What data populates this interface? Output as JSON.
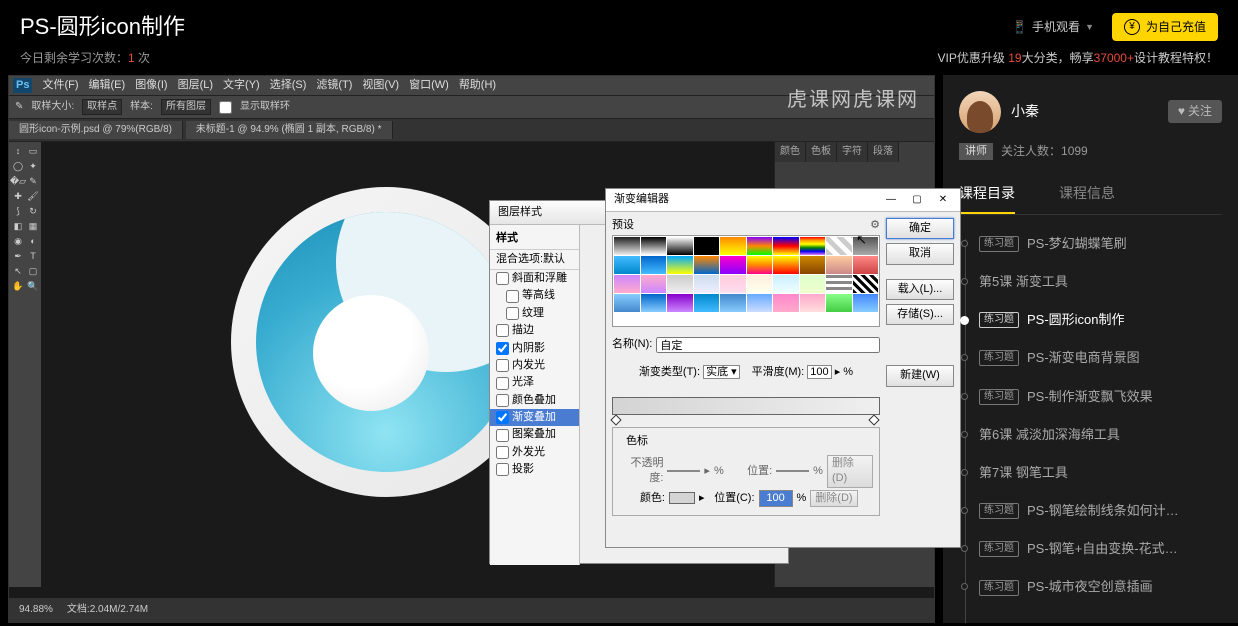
{
  "header": {
    "title": "PS-圆形icon制作",
    "mobile_watch": "手机观看",
    "recharge": "为自己充值"
  },
  "subbar": {
    "study_prefix": "今日剩余学习次数：",
    "study_count": "1",
    "study_suffix": " 次",
    "vip_p1": "VIP优惠升级 ",
    "vip_red1": "19",
    "vip_p2": "大分类，畅享",
    "vip_red2": "37000+",
    "vip_p3": "设计教程特权！"
  },
  "ps": {
    "menu": [
      "文件(F)",
      "编辑(E)",
      "图像(I)",
      "图层(L)",
      "文字(Y)",
      "选择(S)",
      "滤镜(T)",
      "视图(V)",
      "窗口(W)",
      "帮助(H)"
    ],
    "opt": {
      "sample": "取样大小:",
      "sample_val": "取样点",
      "layers": "样本:",
      "layers_val": "所有图层",
      "show": "显示取样环"
    },
    "tabs": [
      "圆形icon-示例.psd @ 79%(RGB/8)",
      "未标题-1 @ 94.9% (椭圆 1 副本, RGB/8) *"
    ],
    "watermark": "虎课网虎课网",
    "panel_tabs": [
      "颜色",
      "色板",
      "字符",
      "段落"
    ],
    "status": {
      "zoom": "94.88%",
      "doc": "文档:2.04M/2.74M"
    }
  },
  "dlg_style": {
    "title": "图层样式",
    "hd": "样式",
    "sub": "混合选项:默认",
    "items": [
      {
        "label": "斜面和浮雕",
        "chk": false
      },
      {
        "label": "等高线",
        "chk": false,
        "indent": true
      },
      {
        "label": "纹理",
        "chk": false,
        "indent": true
      },
      {
        "label": "描边",
        "chk": false
      },
      {
        "label": "内阴影",
        "chk": true
      },
      {
        "label": "内发光",
        "chk": false
      },
      {
        "label": "光泽",
        "chk": false
      },
      {
        "label": "颜色叠加",
        "chk": false
      },
      {
        "label": "渐变叠加",
        "chk": true,
        "sel": true
      },
      {
        "label": "图案叠加",
        "chk": false
      },
      {
        "label": "外发光",
        "chk": false
      },
      {
        "label": "投影",
        "chk": false
      }
    ]
  },
  "dlg_grad": {
    "title": "渐变编辑器",
    "preset_label": "预设",
    "buttons": {
      "ok": "确定",
      "cancel": "取消",
      "load": "载入(L)...",
      "save": "存储(S)...",
      "new": "新建(W)"
    },
    "name_label": "名称(N):",
    "name_val": "自定",
    "type_label": "渐变类型(T):",
    "type_val": "实底",
    "smooth_label": "平滑度(M):",
    "smooth_val": "100",
    "smooth_unit": "%",
    "stops_label": "色标",
    "opacity_label": "不透明度:",
    "opacity_unit": "%",
    "pos_label": "位置:",
    "del1": "删除(D)",
    "color_label": "颜色:",
    "pos_label2": "位置(C):",
    "pos_val": "100",
    "del2": "删除(D)"
  },
  "sidebar": {
    "author_name": "小秦",
    "follow": "关注",
    "teacher_tag": "讲师",
    "followers_label": "关注人数：",
    "followers": "1099",
    "tabs": [
      "课程目录",
      "课程信息"
    ],
    "exercise_tag": "练习题",
    "lessons": [
      {
        "tag": true,
        "label": "PS-梦幻蝴蝶笔刷"
      },
      {
        "tag": false,
        "label": "第5课 渐变工具"
      },
      {
        "tag": true,
        "label": "PS-圆形icon制作",
        "current": true
      },
      {
        "tag": true,
        "label": "PS-渐变电商背景图"
      },
      {
        "tag": true,
        "label": "PS-制作渐变飘飞效果"
      },
      {
        "tag": false,
        "label": "第6课 减淡加深海绵工具"
      },
      {
        "tag": false,
        "label": "第7课 钢笔工具"
      },
      {
        "tag": true,
        "label": "PS-钢笔绘制线条如何计…"
      },
      {
        "tag": true,
        "label": "PS-钢笔+自由变换-花式…"
      },
      {
        "tag": true,
        "label": "PS-城市夜空创意插画"
      }
    ]
  },
  "swatches": [
    "linear-gradient(#222,#eee)",
    "linear-gradient(#000,#fff)",
    "linear-gradient(#fff,#000)",
    "#000",
    "linear-gradient(#f80,#ff0)",
    "linear-gradient(#80f,#f80,#0f0)",
    "linear-gradient(#00f,#f00,#ff0)",
    "linear-gradient(red,orange,yellow,green,blue,violet)",
    "repeating-linear-gradient(45deg,#ccc 0 5px,#fff 5px 10px)",
    "linear-gradient(#555,#aaa)",
    "linear-gradient(#4bf,#08c)",
    "linear-gradient(#06c,#4bf)",
    "linear-gradient(#0af,#ff0)",
    "linear-gradient(#f80,#06c)",
    "linear-gradient(#f0c,#80f)",
    "linear-gradient(#ff0,#f80,#f08)",
    "linear-gradient(#ff0,#f00)",
    "linear-gradient(#c80,#840)",
    "linear-gradient(#fdcba0,#c88)",
    "linear-gradient(#f88,#c44)",
    "linear-gradient(#c8f,#fac)",
    "linear-gradient(#fac,#c8f)",
    "linear-gradient(#ccc,#eee)",
    "linear-gradient(#cde,#eef)",
    "linear-gradient(#fcd,#fde)",
    "linear-gradient(#fed,#ffe)",
    "linear-gradient(#cef,#eff)",
    "linear-gradient(#dfc,#efc)",
    "repeating-linear-gradient(#888 0 3px,#fff 3px 6px)",
    "repeating-linear-gradient(45deg,#000 0 3px,#fff 3px 6px)",
    "linear-gradient(#8cf,#48c)",
    "linear-gradient(#06c,#8cf)",
    "linear-gradient(#80c,#c8f)",
    "linear-gradient(#08c,#4bf)",
    "linear-gradient(#48c,#8cf)",
    "linear-gradient(#6af,#cdf)",
    "linear-gradient(#f8c,#fac)",
    "linear-gradient(#fac,#fdd)",
    "linear-gradient(#8f8,#4c4)",
    "linear-gradient(#48f,#8cf)"
  ]
}
